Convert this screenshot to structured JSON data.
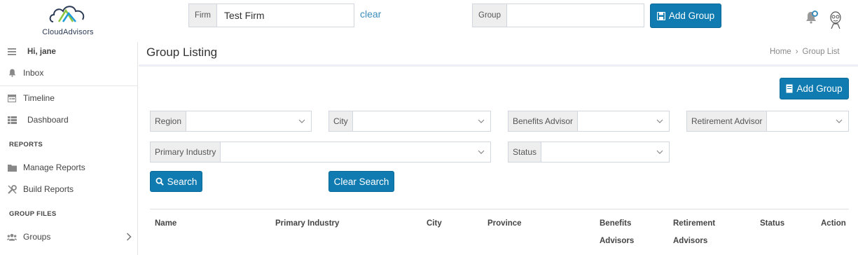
{
  "header": {
    "logo_text": "CloudAdvisors",
    "firm": {
      "label": "Firm",
      "value": "Test Firm"
    },
    "clear_link": "clear",
    "group": {
      "label": "Group",
      "value": ""
    },
    "add_group_label": "Add Group"
  },
  "sidebar": {
    "greeting": "Hi, jane",
    "items": [
      {
        "label": "Inbox",
        "icon": "bell-icon"
      },
      {
        "label": "Timeline",
        "icon": "calendar-icon"
      },
      {
        "label": "Dashboard",
        "icon": "table-icon"
      }
    ],
    "reports_header": "REPORTS",
    "reports": [
      {
        "label": "Manage Reports",
        "icon": "folder-icon"
      },
      {
        "label": "Build Reports",
        "icon": "wrench-icon"
      }
    ],
    "group_files_header": "GROUP FILES",
    "group_files": [
      {
        "label": "Groups",
        "icon": "users-icon"
      }
    ]
  },
  "page": {
    "title": "Group Listing",
    "breadcrumb": [
      "Home",
      "Group List"
    ],
    "add_group_label": "Add Group"
  },
  "filters": {
    "region": "Region",
    "city": "City",
    "benefits_advisor": "Benefits Advisor",
    "retirement_advisor": "Retirement Advisor",
    "primary_industry": "Primary Industry",
    "status": "Status",
    "search_label": "Search",
    "clear_search_label": "Clear Search"
  },
  "table": {
    "columns": [
      "Name",
      "Primary Industry",
      "City",
      "Province",
      [
        "Benefits",
        "Advisors"
      ],
      [
        "Retirement",
        "Advisors"
      ],
      "Status",
      "Action"
    ]
  },
  "colors": {
    "primary_button": "#0f7bb1",
    "link": "#3c8dbc"
  }
}
